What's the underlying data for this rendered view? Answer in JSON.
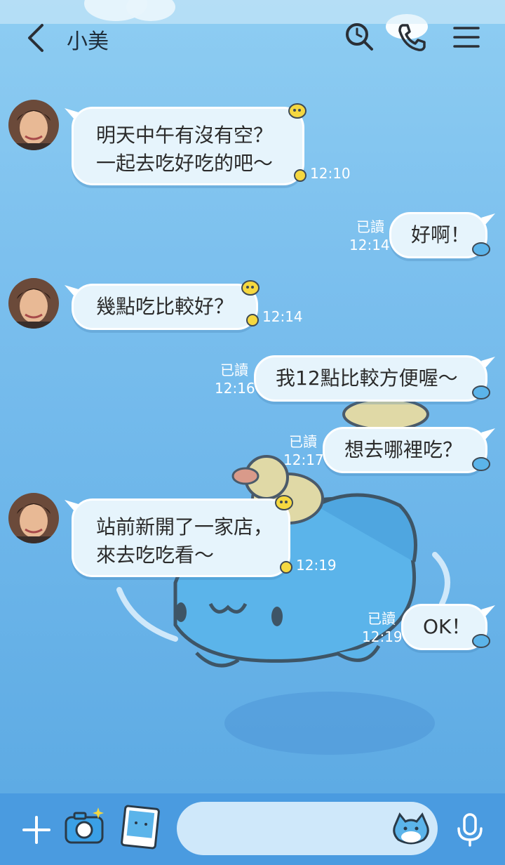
{
  "header": {
    "contact_name": "小美",
    "icons": [
      "back-icon",
      "search-history-icon",
      "phone-icon",
      "menu-icon"
    ]
  },
  "messages": [
    {
      "side": "left",
      "text": "明天中午有沒有空？\n一起去吃好吃的吧～",
      "time": "12:10"
    },
    {
      "side": "right",
      "text": "好啊！",
      "read": "已讀",
      "time": "12:14"
    },
    {
      "side": "left",
      "text": "幾點吃比較好？",
      "time": "12:14"
    },
    {
      "side": "right",
      "text": "我12點比較方便喔～",
      "read": "已讀",
      "time": "12:16"
    },
    {
      "side": "right",
      "text": "想去哪裡吃？",
      "read": "已讀",
      "time": "12:17"
    },
    {
      "side": "left",
      "text": "站前新開了一家店，\n來去吃吃看～",
      "time": "12:19"
    },
    {
      "side": "right",
      "text": "OK！",
      "read": "已讀",
      "time": "12:19"
    }
  ],
  "bottom_bar": {
    "icons": [
      "plus-icon",
      "camera-icon",
      "photo-icon",
      "sticker-icon",
      "mic-icon"
    ],
    "input_placeholder": ""
  },
  "colors": {
    "bubble_fill": "#e6f4fc",
    "bottom_bar": "#4a9be0",
    "background": "#7cc0ee"
  }
}
